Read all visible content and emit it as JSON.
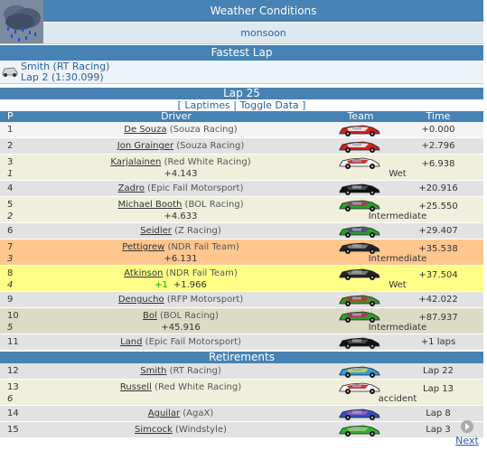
{
  "weather": {
    "title": "Weather Conditions",
    "value": "monsoon",
    "icon": "rain-cloud-icon"
  },
  "fastest_lap": {
    "title": "Fastest Lap",
    "driver": "Smith (RT Racing)",
    "lap": "Lap 2 (1:30.099)"
  },
  "lap": {
    "title": "Lap 25",
    "open": "[",
    "laptimes": "Laptimes",
    "sep": "|",
    "toggle": "Toggle Data",
    "close": "]"
  },
  "table_header": {
    "p": "P",
    "driver": "Driver",
    "team": "Team",
    "time": "Time"
  },
  "results": [
    {
      "pos": "1",
      "name": "De Souza",
      "team": "(Souza Racing)",
      "time": "+0.000",
      "car_color": "#d02020",
      "car_accent": "#ffffff",
      "bg": "bg-white"
    },
    {
      "pos": "2",
      "name": "Jon Grainger",
      "team": "(Souza Racing)",
      "time": "+2.796",
      "car_color": "#d02020",
      "car_accent": "#ffffff",
      "bg": "bg-grey"
    },
    {
      "pos": "3",
      "name": "Karjalainen",
      "team": "(Red White Racing)",
      "time": "+6.938",
      "gap": "1",
      "interval": "+4.143",
      "tyre": "Wet",
      "car_color": "#ffffff",
      "car_accent": "#cc1010",
      "bg": "bg-cream"
    },
    {
      "pos": "4",
      "name": "Zadro",
      "team": "(Epic Fail Motorsport)",
      "time": "+20.916",
      "car_color": "#111111",
      "car_accent": "#555555",
      "bg": "bg-grey"
    },
    {
      "pos": "5",
      "name": "Michael Booth",
      "team": "(BOL Racing)",
      "time": "+25.550",
      "gap": "2",
      "interval": "+4.633",
      "tyre": "Intermediate",
      "car_color": "#2aa030",
      "car_accent": "#d02060",
      "bg": "bg-cream"
    },
    {
      "pos": "6",
      "name": "Seidler",
      "team": "(Z Racing)",
      "time": "+29.407",
      "car_color": "#22a030",
      "car_accent": "#7a2a9a",
      "bg": "bg-grey"
    },
    {
      "pos": "7",
      "name": "Pettigrew",
      "team": "(NDR Fail Team)",
      "time": "+35.538",
      "gap": "3",
      "interval": "+6.131",
      "tyre": "Intermediate",
      "car_color": "#222222",
      "car_accent": "#888888",
      "bg": "bg-orange"
    },
    {
      "pos": "8",
      "name": "Atkinson",
      "team": "(NDR Fail Team)",
      "time": "+37.504",
      "gap": "4",
      "plus": "+1",
      "interval": "+1.966",
      "tyre": "Wet",
      "car_color": "#222222",
      "car_accent": "#888888",
      "bg": "bg-yellow"
    },
    {
      "pos": "9",
      "name": "Dengucho",
      "team": "(RFP Motorsport)",
      "time": "+42.022",
      "car_color": "#4a8a30",
      "car_accent": "#c03030",
      "bg": "bg-grey"
    },
    {
      "pos": "10",
      "name": "Bol",
      "team": "(BOL Racing)",
      "time": "+87.937",
      "gap": "5",
      "interval": "+45.916",
      "tyre": "Intermediate",
      "car_color": "#2aa030",
      "car_accent": "#d02060",
      "bg": "bg-tan"
    },
    {
      "pos": "11",
      "name": "Land",
      "team": "(Epic Fail Motorsport)",
      "time": "+1 laps",
      "car_color": "#111111",
      "car_accent": "#555555",
      "bg": "bg-grey"
    }
  ],
  "retirements_title": "Retirements",
  "retirements": [
    {
      "pos": "12",
      "name": "Smith",
      "team": "(RT Racing)",
      "time": "Lap 22",
      "car_color": "#2aa0e0",
      "car_accent": "#f0d020",
      "bg": "bg-grey"
    },
    {
      "pos": "13",
      "name": "Russell",
      "team": "(Red White Racing)",
      "time": "Lap 13",
      "gap": "6",
      "interval": "",
      "tyre": "accident",
      "car_color": "#ffffff",
      "car_accent": "#cc1010",
      "bg": "bg-cream"
    },
    {
      "pos": "14",
      "name": "Aguilar",
      "team": "(AgaX)",
      "time": "Lap 8",
      "car_color": "#3050c0",
      "car_accent": "#a060c0",
      "bg": "bg-grey"
    },
    {
      "pos": "15",
      "name": "Simcock",
      "team": "(Windstyle)",
      "time": "Lap 3",
      "car_color": "#30b030",
      "car_accent": "#90d060",
      "bg": "bg-grey"
    }
  ],
  "next_label": "Next",
  "next_icon": "arrow-right-icon"
}
